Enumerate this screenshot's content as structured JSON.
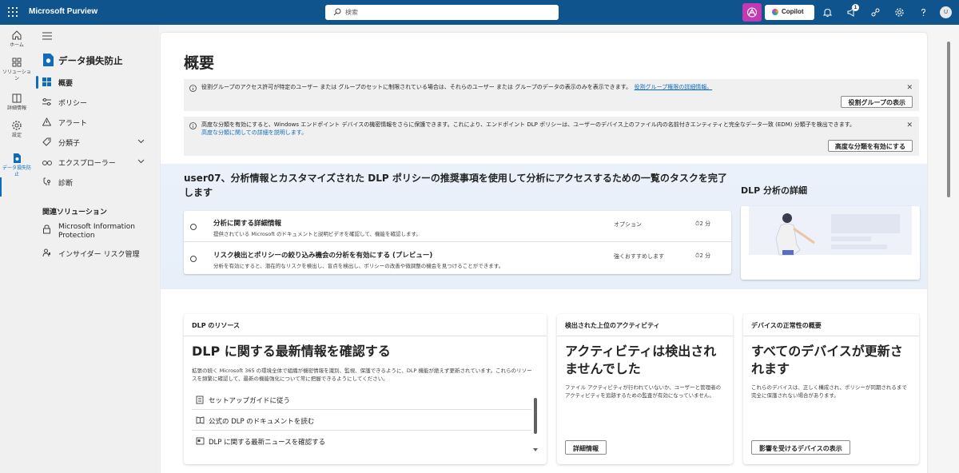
{
  "topbar": {
    "app_name": "Microsoft Purview",
    "search_placeholder": "検索",
    "copilot_label": "Copilot",
    "notification_count": "1",
    "avatar_initial": "U"
  },
  "rail": {
    "items": [
      {
        "label": "ホーム",
        "icon": "home-icon"
      },
      {
        "label": "ソリューション",
        "icon": "grid-icon"
      },
      {
        "label": "詳細情報",
        "icon": "book-icon"
      },
      {
        "label": "設定",
        "icon": "gear-icon"
      },
      {
        "label": "データ損失防止",
        "icon": "dlp-icon"
      }
    ]
  },
  "nav": {
    "title": "データ損失防止",
    "items": [
      {
        "label": "概要",
        "icon": "overview-icon",
        "active": true
      },
      {
        "label": "ポリシー",
        "icon": "sliders-icon"
      },
      {
        "label": "アラート",
        "icon": "warning-icon"
      },
      {
        "label": "分類子",
        "icon": "tag-icon",
        "expandable": true
      },
      {
        "label": "エクスプローラー",
        "icon": "binoculars-icon",
        "expandable": true
      },
      {
        "label": "診断",
        "icon": "diagnostic-icon"
      }
    ],
    "related_heading": "関連ソリューション",
    "related": [
      {
        "label": "Microsoft Information Protection",
        "icon": "shield-lock-icon"
      },
      {
        "label": "インサイダー リスク管理",
        "icon": "person-icon"
      }
    ]
  },
  "main": {
    "title": "概要",
    "banner1": {
      "text": "役割グループのアクセス許可が特定のユーザー または グループのセットに制限されている場合は、それらのユーザー または グループのデータの表示のみを表示できます。",
      "link": "役割グループ権限の詳細情報。",
      "button": "役割グループの表示"
    },
    "banner2": {
      "text": "高度な分類を有効にすると、Windows エンドポイント デバイスの機密情報をさらに保護できます。これにより、エンドポイント DLP ポリシーは、ユーザーのデバイス上のファイル内の名前付きエンティティと完全なデータ一致 (EDM) 分類子を検出できます。",
      "link": "高度な分類に関しての詳細を説明します。",
      "button": "高度な分類を有効にする"
    },
    "tasks_title": "user07、分析情報とカスタマイズされた DLP ポリシーの推奨事項を使用して分析にアクセスするための一覧のタスクを完了します",
    "tasks": [
      {
        "title": "分析に関する詳細情報",
        "desc": "提供されている Microsoft のドキュメントと説明ビデオを確認して、機能を確認します。",
        "tag": "オプション",
        "duration": "2 分"
      },
      {
        "title": "リスク検出とポリシーの絞り込み機会の分析を有効にする (プレビュー)",
        "desc": "分析を有効にすると、潜在的なリスクを検出し、盲点を検出し、ポリシーの改善や微調整の機会を見つけることができます。",
        "tag": "強くおすすめします",
        "duration": "2 分"
      }
    ],
    "dlp_analysis_title": "DLP 分析の詳細",
    "cards": {
      "resources": {
        "header": "DLP のリソース",
        "big": "DLP に関する最新情報を確認する",
        "desc": "拡張の続く Microsoft 365 の環境全体で組織が機密情報を識別、監視、保護できるように、DLP 機能が絶えず更新されています。これらのリソースを頻繁に確認して、最新の機能強化について常に把握できるようにしてください。",
        "items": [
          {
            "label": "セットアップガイドに従う",
            "icon": "checklist-icon"
          },
          {
            "label": "公式の DLP のドキュメントを読む",
            "icon": "book-open-icon"
          },
          {
            "label": "DLP に関する最新ニュースを確認する",
            "icon": "news-icon"
          }
        ]
      },
      "activities": {
        "header": "検出された上位のアクティビティ",
        "big": "アクティビティは検出されませんでした",
        "desc": "ファイル アクティビティが行われていないか、ユーザーと管理者のアクティビティを追跡するための監査が有効になっていません。",
        "button": "詳細情報"
      },
      "devices": {
        "header": "デバイスの正常性の概要",
        "big": "すべてのデバイスが更新されます",
        "desc": "これらのデバイスは、正しく構成され、ポリシーが同期されるまで完全に保護されない場合があります。",
        "button": "影響を受けるデバイスの表示"
      }
    }
  },
  "colors": {
    "topbar": "#0f548c",
    "accent": "#0f6cbd",
    "copilot_button": "#c239b3"
  }
}
